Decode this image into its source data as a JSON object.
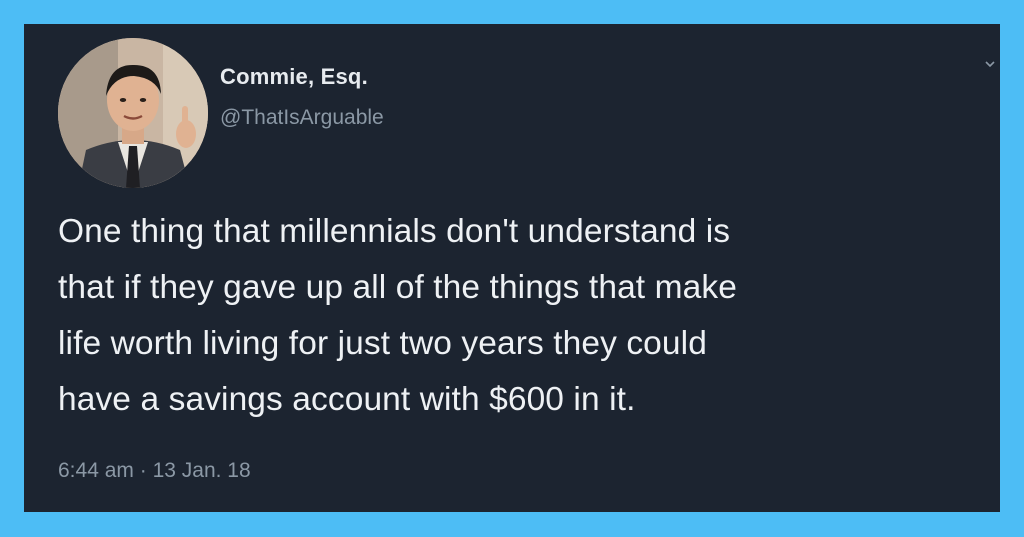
{
  "colors": {
    "page_background": "#4dbdf5",
    "card_background": "#1c2430",
    "primary_text": "#eef1f4",
    "secondary_text": "#8b98a5"
  },
  "tweet": {
    "author": {
      "display_name": "Commie, Esq.",
      "handle": "@ThatIsArguable",
      "avatar_icon": "profile-photo"
    },
    "text_lines": [
      "One thing that millennials don't understand is",
      "that if they gave up all of the things that make",
      "life worth living for just two years they could",
      "have a savings account with $600 in it."
    ],
    "meta": {
      "time": "6:44 am",
      "separator": "·",
      "date": "13 Jan. 18"
    },
    "menu_icon": "chevron-down-icon"
  }
}
